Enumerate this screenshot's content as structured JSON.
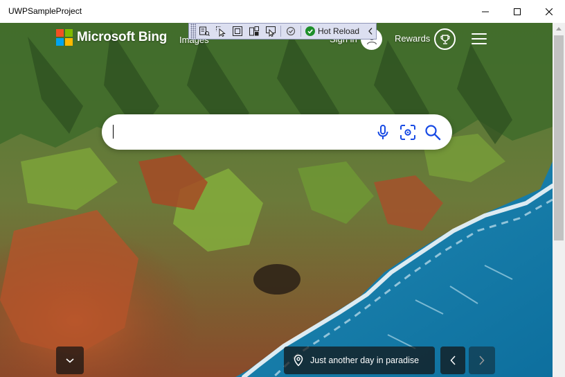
{
  "window": {
    "title": "UWPSampleProject",
    "controls": [
      "minimize-icon",
      "maximize-icon",
      "close-icon"
    ]
  },
  "debug_toolbar": {
    "tools": [
      "live-visual-tree-icon",
      "select-element-icon",
      "display-layout-adorners-icon",
      "track-focus-icon",
      "preview-selection-icon",
      "binding-failures-icon"
    ],
    "hot_reload_label": "Hot Reload",
    "hot_reload_status": "up-to-date"
  },
  "header": {
    "brand": "Microsoft Bing",
    "logo_colors": [
      "#f25022",
      "#7fba00",
      "#00a4ef",
      "#ffb900"
    ],
    "nav": {
      "images": "Images",
      "sign_in": "Sign in",
      "rewards": "Rewards"
    },
    "icons": [
      "avatar-icon",
      "rewards-trophy-icon",
      "menu-icon"
    ]
  },
  "search": {
    "value": "",
    "placeholder": "",
    "icons": [
      "microphone-icon",
      "visual-search-icon",
      "search-icon"
    ],
    "icon_color": "#174ae4"
  },
  "footer": {
    "caption": "Just another day in paradise",
    "icons": [
      "chevron-down-icon",
      "location-pin-icon",
      "chevron-left-icon",
      "chevron-right-icon"
    ]
  },
  "colors": {
    "ocean": "#1e88b4",
    "cliff_green": "#5e8a2c",
    "cliff_red": "#b3502a",
    "toolbar_bg": "#dcdff0"
  }
}
